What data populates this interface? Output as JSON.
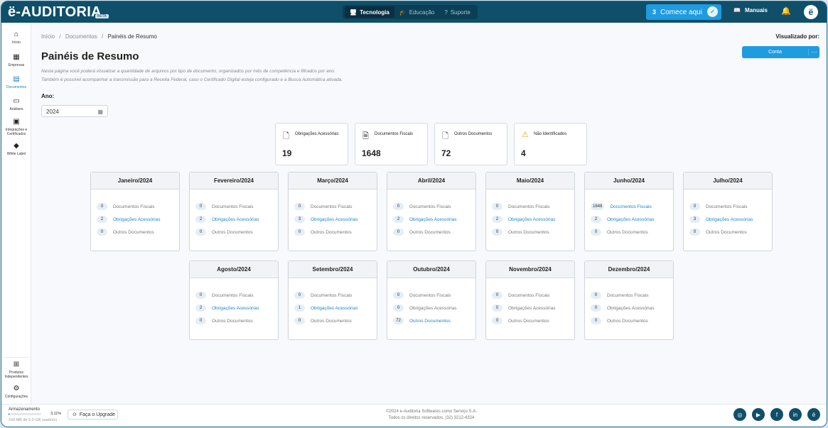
{
  "header": {
    "logo": "ë-AUDITORIA",
    "beta": "BETA",
    "nav": [
      {
        "label": "Tecnologia",
        "icon": "monitor-icon",
        "active": true
      },
      {
        "label": "Educação",
        "icon": "graduation-cap-icon",
        "active": false
      },
      {
        "label": "Suporte",
        "icon": "help-icon",
        "active": false
      }
    ],
    "cta_count": "3",
    "cta_label": "Comece aqui",
    "manuals": "Manuais"
  },
  "sidebar": {
    "items": [
      {
        "label": "Início",
        "icon": "home-icon"
      },
      {
        "label": "Empresas",
        "icon": "building-icon"
      },
      {
        "label": "Documentos",
        "icon": "document-icon"
      },
      {
        "label": "Análises",
        "icon": "analysis-icon"
      },
      {
        "label": "Integrações e Certificados",
        "icon": "integration-icon"
      },
      {
        "label": "White Label",
        "icon": "diamond-icon"
      }
    ],
    "bottom": [
      {
        "label": "Produtos Independentes",
        "icon": "grid-icon"
      },
      {
        "label": "Configurações",
        "icon": "gear-icon"
      }
    ]
  },
  "breadcrumb": {
    "home": "Início",
    "sep": "/",
    "section": "Documentos",
    "current": "Painéis de Resumo"
  },
  "page": {
    "title": "Painéis de Resumo",
    "desc1": "Nesta página você poderá visualizar a quantidade de arquivos por tipo de documento, organizados por mês de competência e filtrados por ano.",
    "desc2": "Também é possível acompanhar a transmissão para a Receita Federal, caso o Certificado Digital esteja configurado e a Busca Automática ativada.",
    "viewby_label": "Visualizado por:",
    "viewby_value": "Conta",
    "viewby_more": "···",
    "year_label": "Ano:",
    "year_value": "2024"
  },
  "stats": [
    {
      "label": "Obrigações Acessórias",
      "value": "19",
      "icon": "file-icon"
    },
    {
      "label": "Documentos Fiscais",
      "value": "1648",
      "icon": "file-text-icon"
    },
    {
      "label": "Outros Documentos",
      "value": "72",
      "icon": "file-icon"
    },
    {
      "label": "Não Identificados",
      "value": "4",
      "icon": "warning-icon"
    }
  ],
  "labels": {
    "fiscais": "Documentos Fiscais",
    "acessorias": "Obrigações Acessórias",
    "outros": "Outros Documentos"
  },
  "months": [
    {
      "name": "Janeiro/2024",
      "fiscais": "0",
      "acessorias": "2",
      "outros": "0"
    },
    {
      "name": "Fevereiro/2024",
      "fiscais": "0",
      "acessorias": "2",
      "outros": "0"
    },
    {
      "name": "Março/2024",
      "fiscais": "0",
      "acessorias": "3",
      "outros": "0"
    },
    {
      "name": "Abril/2024",
      "fiscais": "0",
      "acessorias": "2",
      "outros": "0"
    },
    {
      "name": "Maio/2024",
      "fiscais": "0",
      "acessorias": "2",
      "outros": "0"
    },
    {
      "name": "Junho/2024",
      "fiscais": "1648",
      "acessorias": "2",
      "outros": "0"
    },
    {
      "name": "Julho/2024",
      "fiscais": "0",
      "acessorias": "3",
      "outros": "0"
    },
    {
      "name": "Agosto/2024",
      "fiscais": "0",
      "acessorias": "2",
      "outros": "0"
    },
    {
      "name": "Setembro/2024",
      "fiscais": "0",
      "acessorias": "1",
      "outros": "0"
    },
    {
      "name": "Outubro/2024",
      "fiscais": "0",
      "acessorias": "0",
      "outros": "72"
    },
    {
      "name": "Novembro/2024",
      "fiscais": "0",
      "acessorias": "0",
      "outros": "0"
    },
    {
      "name": "Dezembro/2024",
      "fiscais": "0",
      "acessorias": "0",
      "outros": "0"
    }
  ],
  "footer": {
    "storage_label": "Armazenamento",
    "storage_pct": "3,11%",
    "storage_fraction": 0.0311,
    "storage_used": "159 MB de 5.0 GB usado(s)",
    "upgrade": "Faça o Upgrade",
    "copy1": "©2024 e-Auditoria Softwares como Serviço S.A.",
    "copy2": "Todos os direitos reservados. (32) 3212-4324",
    "social": [
      "instagram-icon",
      "youtube-icon",
      "facebook-icon",
      "linkedin-icon",
      "e-auditoria-icon"
    ]
  }
}
